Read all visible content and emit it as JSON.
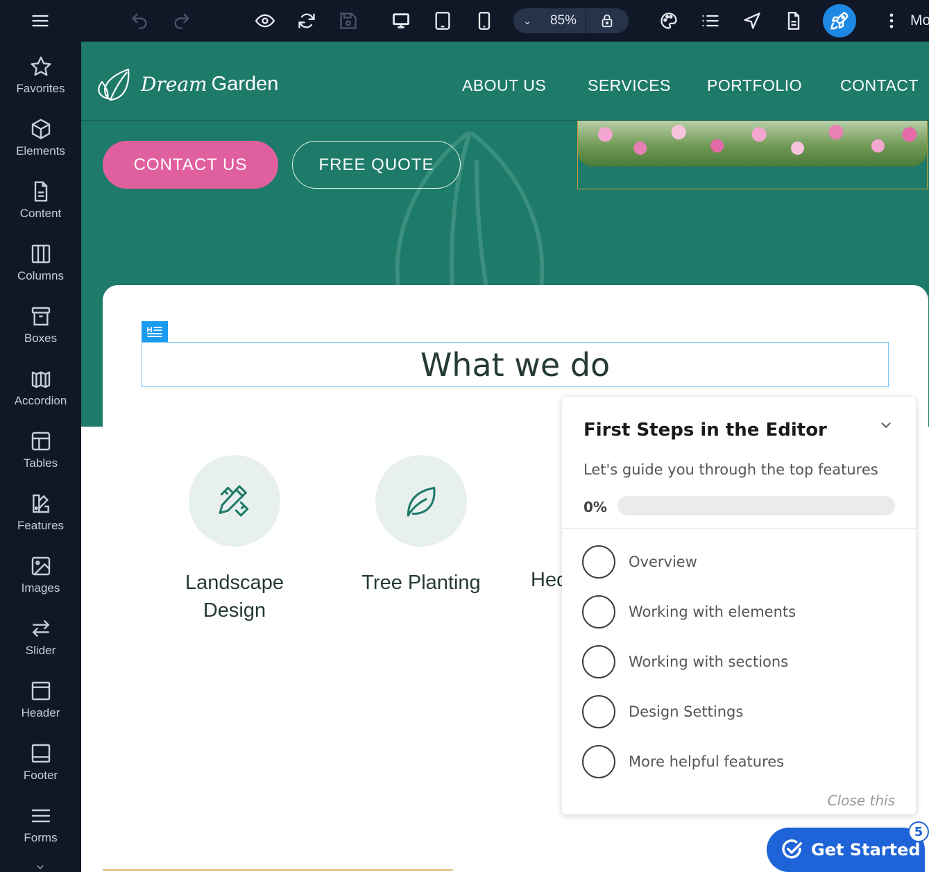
{
  "toolbar": {
    "zoom": "85%",
    "more_label": "Mo"
  },
  "sidebar": {
    "items": [
      {
        "label": "Favorites",
        "icon": "star-icon"
      },
      {
        "label": "Elements",
        "icon": "cube-icon"
      },
      {
        "label": "Content",
        "icon": "document-icon"
      },
      {
        "label": "Columns",
        "icon": "columns-icon"
      },
      {
        "label": "Boxes",
        "icon": "box-icon"
      },
      {
        "label": "Accordion",
        "icon": "accordion-icon"
      },
      {
        "label": "Tables",
        "icon": "table-icon"
      },
      {
        "label": "Features",
        "icon": "features-icon"
      },
      {
        "label": "Images",
        "icon": "image-icon"
      },
      {
        "label": "Slider",
        "icon": "slider-icon"
      },
      {
        "label": "Header",
        "icon": "header-icon"
      },
      {
        "label": "Footer",
        "icon": "footer-icon"
      },
      {
        "label": "Forms",
        "icon": "forms-icon"
      }
    ]
  },
  "site": {
    "logo_dream": "Dream",
    "logo_garden": "Garden",
    "nav": [
      "ABOUT US",
      "SERVICES",
      "PORTFOLIO",
      "CONTACT"
    ],
    "cta_primary": "CONTACT US",
    "cta_secondary": "FREE QUOTE",
    "section_heading": "What we do",
    "services": [
      {
        "title_line1": "Landscape",
        "title_line2": "Design"
      },
      {
        "title_line1": "Tree Planting",
        "title_line2": ""
      }
    ],
    "service_partial": "Hed"
  },
  "first_steps": {
    "title": "First Steps in the Editor",
    "subtitle": "Let's guide you through the top features",
    "progress_label": "0%",
    "progress_fraction": 0,
    "steps": [
      "Overview",
      "Working with elements",
      "Working with sections",
      "Design Settings",
      "More helpful features"
    ],
    "close_label": "Close this"
  },
  "get_started": {
    "label": "Get Started",
    "badge": "5"
  },
  "colors": {
    "toolbar_bg": "#101828",
    "hero_green": "#1e7a69",
    "cta_pink": "#e0609f",
    "accent_blue": "#1e88e5"
  }
}
